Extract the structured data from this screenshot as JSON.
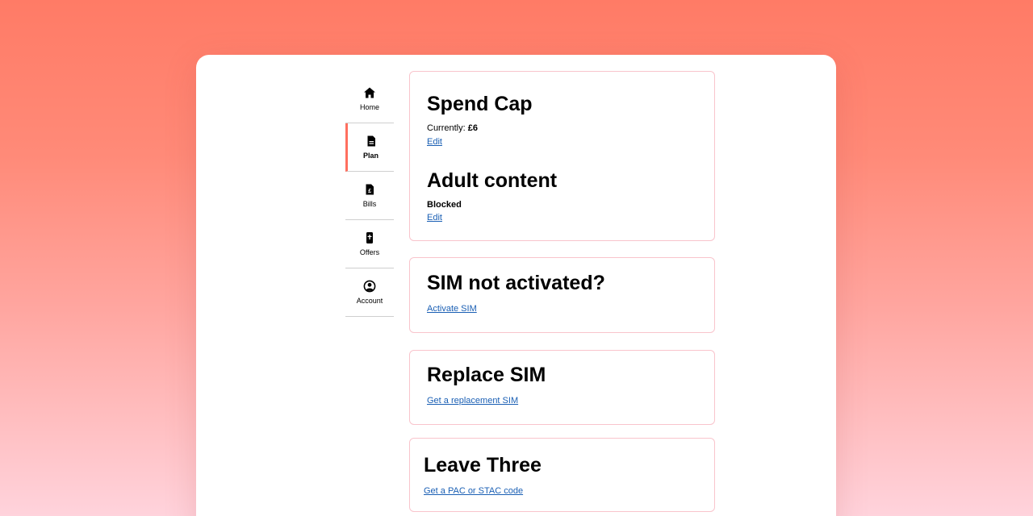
{
  "nav": {
    "items": [
      {
        "label": "Home",
        "icon": "home-icon"
      },
      {
        "label": "Plan",
        "icon": "document-icon",
        "active": true
      },
      {
        "label": "Bills",
        "icon": "bill-icon"
      },
      {
        "label": "Offers",
        "icon": "mobile-offer-icon"
      },
      {
        "label": "Account",
        "icon": "user-circle-icon"
      }
    ]
  },
  "cards": {
    "settings": {
      "spend_cap_title": "Spend Cap",
      "spend_cap_prefix": "Currently: ",
      "spend_cap_value": "£6",
      "spend_cap_edit": "Edit",
      "adult_title": "Adult content",
      "adult_status": "Blocked",
      "adult_edit": "Edit"
    },
    "activate": {
      "title": "SIM not activated?",
      "link": "Activate SIM"
    },
    "replace": {
      "title": "Replace SIM",
      "link": "Get a replacement SIM"
    },
    "leave": {
      "title": "Leave Three",
      "link": "Get a PAC or STAC code"
    }
  },
  "colors": {
    "accent": "#ff6f5f",
    "card_border": "#f9c4cc",
    "link": "#1a5fb4"
  }
}
